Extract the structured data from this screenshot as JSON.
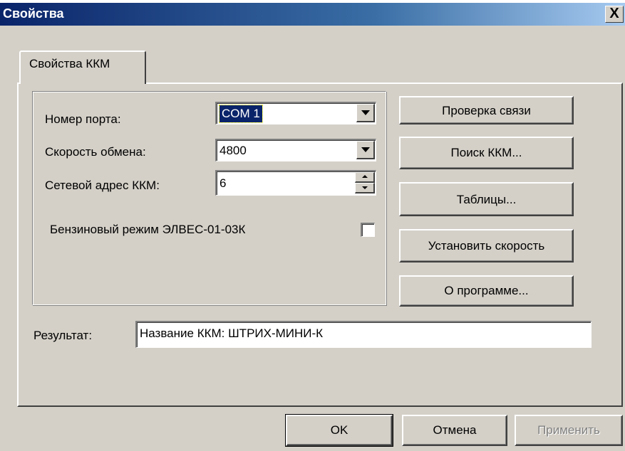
{
  "window": {
    "title": "Свойства",
    "close_label": "X"
  },
  "tabs": [
    {
      "label": "Свойства ККМ"
    }
  ],
  "form": {
    "port_label": "Номер порта:",
    "port_value": "COM 1",
    "speed_label": "Скорость обмена:",
    "speed_value": "4800",
    "address_label": "Сетевой адрес ККМ:",
    "address_value": "6",
    "petrol_mode_label": "Бензиновый режим ЭЛВЕС-01-03К",
    "petrol_mode_checked": false
  },
  "side_buttons": {
    "check_connection": "Проверка связи",
    "find_kkm": "Поиск ККМ...",
    "tables": "Таблицы...",
    "set_speed": "Установить скорость",
    "about": "О программе..."
  },
  "result": {
    "label": "Результат:",
    "value": "Название ККМ: ШТРИХ-МИНИ-К"
  },
  "footer": {
    "ok": "OK",
    "cancel": "Отмена",
    "apply": "Применить"
  },
  "colors": {
    "title_start": "#0a246a",
    "title_end": "#a6caf0",
    "face": "#d4d0c8"
  }
}
